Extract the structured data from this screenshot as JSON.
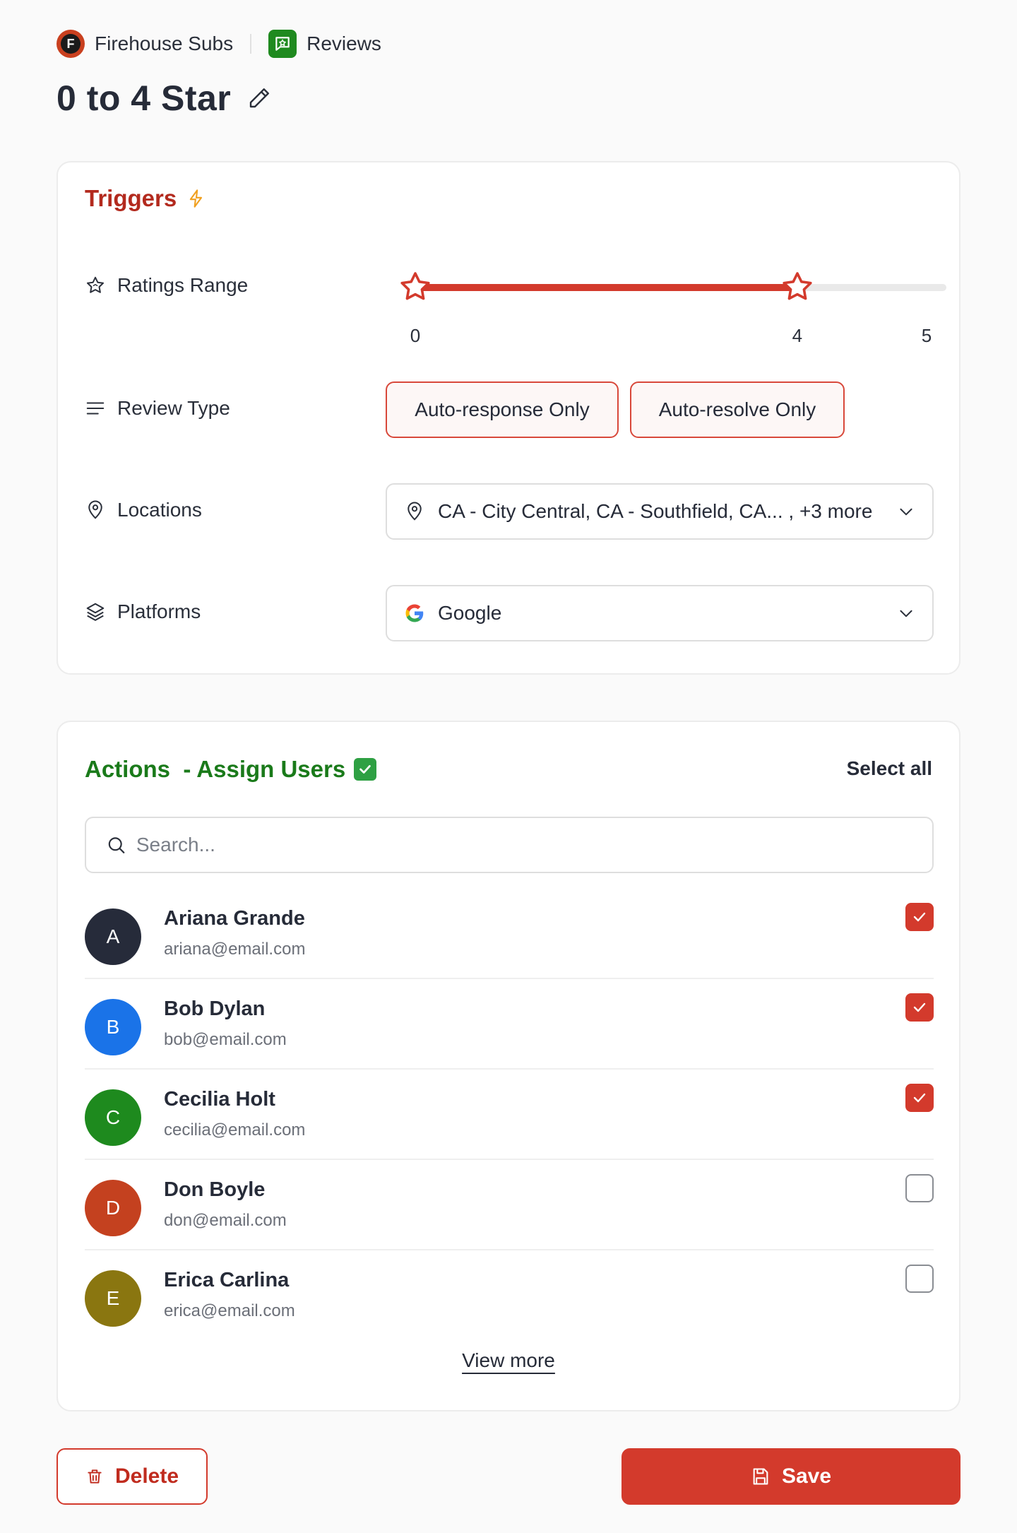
{
  "breadcrumb": {
    "brand": "Firehouse Subs",
    "brand_initial": "F",
    "section": "Reviews"
  },
  "page": {
    "title": "0 to 4 Star"
  },
  "triggers": {
    "title": "Triggers",
    "ratings_range": {
      "label": "Ratings Range",
      "min": 0,
      "max": 5,
      "low_value": 0,
      "high_value": 4,
      "tick_low": "0",
      "tick_high": "4",
      "tick_max": "5"
    },
    "review_type": {
      "label": "Review Type",
      "options": [
        "Auto-response Only",
        "Auto-resolve Only"
      ]
    },
    "locations": {
      "label": "Locations",
      "value": "CA - City Central, CA - Southfield, CA... , +3 more"
    },
    "platforms": {
      "label": "Platforms",
      "value": "Google"
    }
  },
  "actions": {
    "title": "Actions  - Assign Users",
    "select_all": "Select all",
    "search_placeholder": "Search...",
    "users": [
      {
        "initial": "A",
        "name": "Ariana Grande",
        "email": "ariana@email.com",
        "checked": true,
        "color": "#262b3a"
      },
      {
        "initial": "B",
        "name": "Bob Dylan",
        "email": "bob@email.com",
        "checked": true,
        "color": "#1a73e8"
      },
      {
        "initial": "C",
        "name": "Cecilia Holt",
        "email": "cecilia@email.com",
        "checked": true,
        "color": "#1e8a1e"
      },
      {
        "initial": "D",
        "name": "Don Boyle",
        "email": "don@email.com",
        "checked": false,
        "color": "#c4411f"
      },
      {
        "initial": "E",
        "name": "Erica Carlina",
        "email": "erica@email.com",
        "checked": false,
        "color": "#8a7610"
      }
    ],
    "view_more": "View more"
  },
  "footer": {
    "delete_label": "Delete",
    "save_label": "Save"
  },
  "colors": {
    "accent": "#d33a2c",
    "triggers_title": "#b32a1e",
    "actions_title": "#1a7a1a"
  }
}
